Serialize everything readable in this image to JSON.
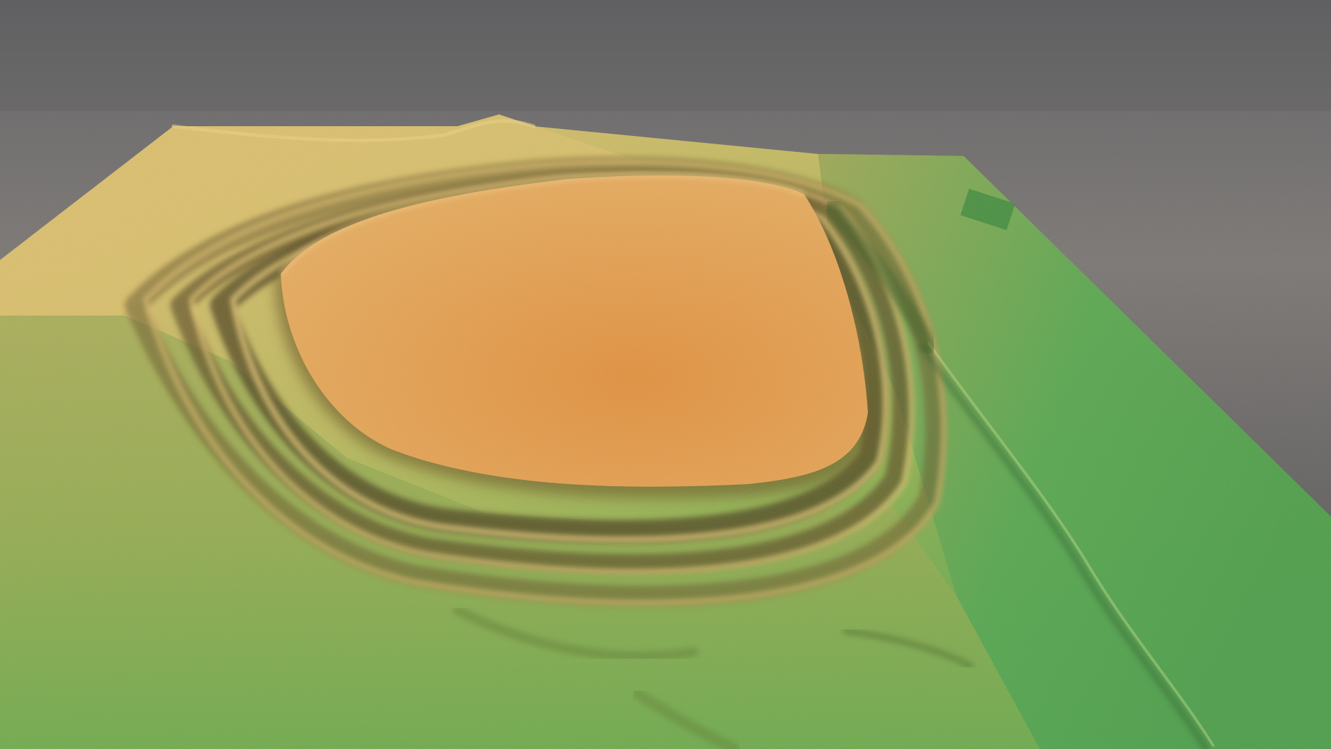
{
  "scene": {
    "subject": "hillfort-terrain-model",
    "colors": {
      "background_top": "#606062",
      "background_mid": "#7a7673",
      "background_bottom": "#4c4c4e",
      "plateau_light": "#e6ac5f",
      "plateau_dark": "#e2913e",
      "upper_plain": "#d9bd6c",
      "slope_mid": "#b9b85d",
      "slope_green": "#8eb050",
      "edge_green": "#53a64f",
      "deep_green": "#4c9d49",
      "rampart_shadow": "#5a4a22",
      "rampart_highlight": "#f0cf7a"
    }
  }
}
